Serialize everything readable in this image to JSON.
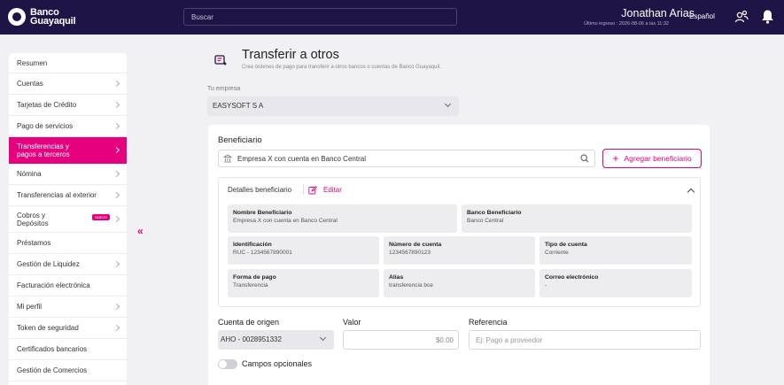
{
  "header": {
    "logo_line1": "Banco",
    "logo_line2": "Guayaquil",
    "search_placeholder": "Buscar",
    "user_name": "Jonathan Arias",
    "last_login": "Último ingreso : 2026-08-06 a las 11:32",
    "language": "Español"
  },
  "sidebar": {
    "items": [
      {
        "label": "Resumen",
        "chevron": false
      },
      {
        "label": "Cuentas",
        "chevron": true
      },
      {
        "label": "Tarjetas de Crédito",
        "chevron": true
      },
      {
        "label": "Pago de servicios",
        "chevron": true
      },
      {
        "label": "Transferencias y",
        "label2": "pagos a terceros",
        "chevron": true,
        "active": true
      },
      {
        "label": "Nómina",
        "chevron": true
      },
      {
        "label": "Transferencias al exterior",
        "chevron": true
      },
      {
        "label": "Cobros y",
        "label2": "Depósitos",
        "chevron": true,
        "badge": "NUEVO"
      },
      {
        "label": "Préstamos",
        "chevron": false
      },
      {
        "label": "Gestión de Liquidez",
        "chevron": true
      },
      {
        "label": "Facturación electrónica",
        "chevron": false
      },
      {
        "label": "Mi perfil",
        "chevron": true
      },
      {
        "label": "Token de seguridad",
        "chevron": true
      },
      {
        "label": "Certificados bancarios",
        "chevron": false
      },
      {
        "label": "Gestión de Comercios",
        "chevron": false
      }
    ],
    "collapse_glyph": "«"
  },
  "page": {
    "title": "Transferir a otros",
    "subtitle": "Crea órdenes de pago para transferir a otros bancos o cuentas de Banco Guayaquil.",
    "company_label": "Tu empresa",
    "company_value": "EASYSOFT S A"
  },
  "beneficiary": {
    "title": "Beneficiario",
    "selected": "Empresa X con cuenta en Banco Central",
    "add_button": "Agregar beneficiario",
    "details_title": "Detalles beneficiario",
    "edit_label": "Editar",
    "fields": {
      "name": {
        "label": "Nombre Beneficiario",
        "value": "Empresa X con cuenta en Banco Central"
      },
      "bank": {
        "label": "Banco Beneficiario",
        "value": "Banco Central"
      },
      "id": {
        "label": "Identificación",
        "value": "RUC - 1234567890001"
      },
      "account": {
        "label": "Número de cuenta",
        "value": "1234567890123"
      },
      "account_type": {
        "label": "Tipo de cuenta",
        "value": "Corriente"
      },
      "payment": {
        "label": "Forma de pago",
        "value": "Transferencia"
      },
      "alias": {
        "label": "Alias",
        "value": "transferencia bce"
      },
      "email": {
        "label": "Correo electrónico",
        "value": "-"
      }
    }
  },
  "form": {
    "origin_label": "Cuenta de origen",
    "origin_value": "AHO - 0028951332",
    "value_label": "Valor",
    "value_value": "$0.00",
    "reference_label": "Referencia",
    "reference_placeholder": "Ej: Pago a proveedor",
    "optional_label": "Campos opcionales"
  },
  "colors": {
    "brand_dark": "#1e1446",
    "accent": "#e6007e"
  }
}
